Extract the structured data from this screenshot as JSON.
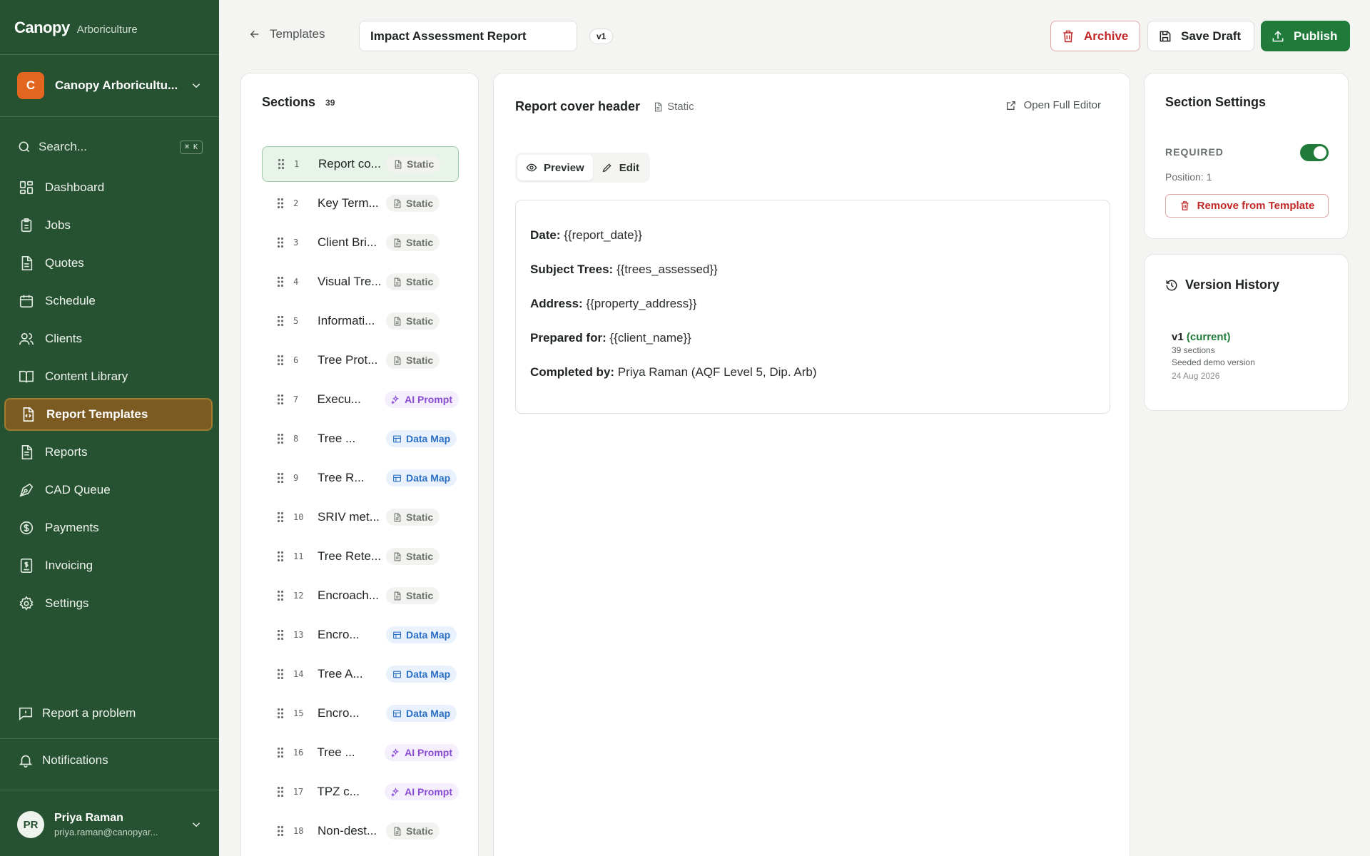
{
  "brand": {
    "name": "Canopy",
    "sub": "Arboriculture"
  },
  "org": {
    "initial": "C",
    "name": "Canopy Arboricultu..."
  },
  "search": {
    "placeholder": "Search...",
    "shortcut": "⌘ K"
  },
  "nav": [
    {
      "label": "Dashboard",
      "icon": "dashboard-icon"
    },
    {
      "label": "Jobs",
      "icon": "clipboard-icon"
    },
    {
      "label": "Quotes",
      "icon": "document-icon"
    },
    {
      "label": "Schedule",
      "icon": "calendar-icon"
    },
    {
      "label": "Clients",
      "icon": "users-icon"
    },
    {
      "label": "Content Library",
      "icon": "book-icon"
    },
    {
      "label": "Report Templates",
      "icon": "file-code-icon",
      "active": true
    },
    {
      "label": "Reports",
      "icon": "file-text-icon"
    },
    {
      "label": "CAD Queue",
      "icon": "pen-tool-icon"
    },
    {
      "label": "Payments",
      "icon": "dollar-circle-icon"
    },
    {
      "label": "Invoicing",
      "icon": "invoice-icon"
    },
    {
      "label": "Settings",
      "icon": "gear-icon"
    }
  ],
  "bottom": {
    "report_problem": "Report a problem",
    "notifications": "Notifications"
  },
  "user": {
    "initials": "PR",
    "name": "Priya Raman",
    "email": "priya.raman@canopyar..."
  },
  "header": {
    "back_label": "Templates",
    "title_value": "Impact Assessment Report",
    "version": "v1",
    "archive": "Archive",
    "save_draft": "Save Draft",
    "publish": "Publish"
  },
  "sections": {
    "title": "Sections",
    "count": "39",
    "items": [
      {
        "num": "1",
        "name": "Report co...",
        "type": "Static",
        "kind": "static",
        "selected": true
      },
      {
        "num": "2",
        "name": "Key Term...",
        "type": "Static",
        "kind": "static"
      },
      {
        "num": "3",
        "name": "Client Bri...",
        "type": "Static",
        "kind": "static"
      },
      {
        "num": "4",
        "name": "Visual Tre...",
        "type": "Static",
        "kind": "static"
      },
      {
        "num": "5",
        "name": "Informati...",
        "type": "Static",
        "kind": "static"
      },
      {
        "num": "6",
        "name": "Tree Prot...",
        "type": "Static",
        "kind": "static"
      },
      {
        "num": "7",
        "name": "Execu...",
        "type": "AI Prompt",
        "kind": "ai"
      },
      {
        "num": "8",
        "name": "Tree ...",
        "type": "Data Map",
        "kind": "map"
      },
      {
        "num": "9",
        "name": "Tree R...",
        "type": "Data Map",
        "kind": "map"
      },
      {
        "num": "10",
        "name": "SRIV met...",
        "type": "Static",
        "kind": "static"
      },
      {
        "num": "11",
        "name": "Tree Rete...",
        "type": "Static",
        "kind": "static"
      },
      {
        "num": "12",
        "name": "Encroach...",
        "type": "Static",
        "kind": "static"
      },
      {
        "num": "13",
        "name": "Encro...",
        "type": "Data Map",
        "kind": "map"
      },
      {
        "num": "14",
        "name": "Tree A...",
        "type": "Data Map",
        "kind": "map"
      },
      {
        "num": "15",
        "name": "Encro...",
        "type": "Data Map",
        "kind": "map"
      },
      {
        "num": "16",
        "name": "Tree ...",
        "type": "AI Prompt",
        "kind": "ai"
      },
      {
        "num": "17",
        "name": "TPZ c...",
        "type": "AI Prompt",
        "kind": "ai"
      },
      {
        "num": "18",
        "name": "Non-dest...",
        "type": "Static",
        "kind": "static"
      }
    ]
  },
  "editor": {
    "title": "Report cover header",
    "tag": "Static",
    "open_full": "Open Full Editor",
    "preview_tab": "Preview",
    "edit_tab": "Edit",
    "lines": [
      {
        "label": "Date:",
        "value": "{{report_date}}"
      },
      {
        "label": "Subject Trees:",
        "value": "{{trees_assessed}}"
      },
      {
        "label": "Address:",
        "value": "{{property_address}}"
      },
      {
        "label": "Prepared for:",
        "value": "{{client_name}}"
      },
      {
        "label": "Completed by:",
        "value": "Priya Raman (AQF Level 5, Dip. Arb)"
      }
    ]
  },
  "settings": {
    "title": "Section Settings",
    "required_label": "REQUIRED",
    "required": true,
    "position": "Position: 1",
    "remove": "Remove from Template"
  },
  "history": {
    "title": "Version History",
    "version": "v1",
    "current": "(current)",
    "sections": "39 sections",
    "note": "Seeded demo version",
    "date": "24 Aug 2026"
  },
  "colors": {
    "sidebar": "#265231",
    "accent": "#207a3a",
    "danger": "#c22828",
    "active_nav": "#7b5b22"
  }
}
